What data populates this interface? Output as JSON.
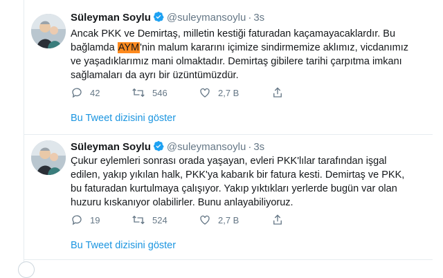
{
  "tweets": [
    {
      "name": "Süleyman Soylu",
      "handle": "@suleymansoylu",
      "separator": "·",
      "time": "3s",
      "text_before": "Ancak PKK ve Demirtaş, milletin kestiği faturadan kaçamayacaklardır. Bu bağlamda ",
      "highlight": "AYM",
      "text_after": "'nin malum kararını içimize sindirmemize aklımız, vicdanımız ve yaşadıklarımız mani olmaktadır. Demirtaş gibilere tarihi çarpıtma imkanı sağlamaları da ayrı bir üzüntümüzdür.",
      "replies": "42",
      "retweets": "546",
      "likes": "2,7 B",
      "show_thread": "Bu Tweet dizisini göster"
    },
    {
      "name": "Süleyman Soylu",
      "handle": "@suleymansoylu",
      "separator": "·",
      "time": "3s",
      "text": "Çukur eylemleri sonrası orada yaşayan, evleri PKK'lılar tarafından işgal edilen, yakıp yıkılan halk, PKK'ya kabarık bir fatura kesti. Demirtaş ve PKK, bu faturadan kurtulmaya çalışıyor. Yakıp yıktıkları yerlerde bugün var olan huzuru kıskanıyor olabilirler. Bunu anlayabiliyoruz.",
      "replies": "19",
      "retweets": "524",
      "likes": "2,7 B",
      "show_thread": "Bu Tweet dizisini göster"
    }
  ],
  "icons": {
    "verified": "verified-badge-icon",
    "reply": "reply-icon",
    "retweet": "retweet-icon",
    "like": "heart-icon",
    "share": "share-icon"
  },
  "colors": {
    "link": "#1b95e0",
    "muted": "#657786",
    "highlight": "#ff8a1e",
    "verified": "#1da1f2"
  }
}
